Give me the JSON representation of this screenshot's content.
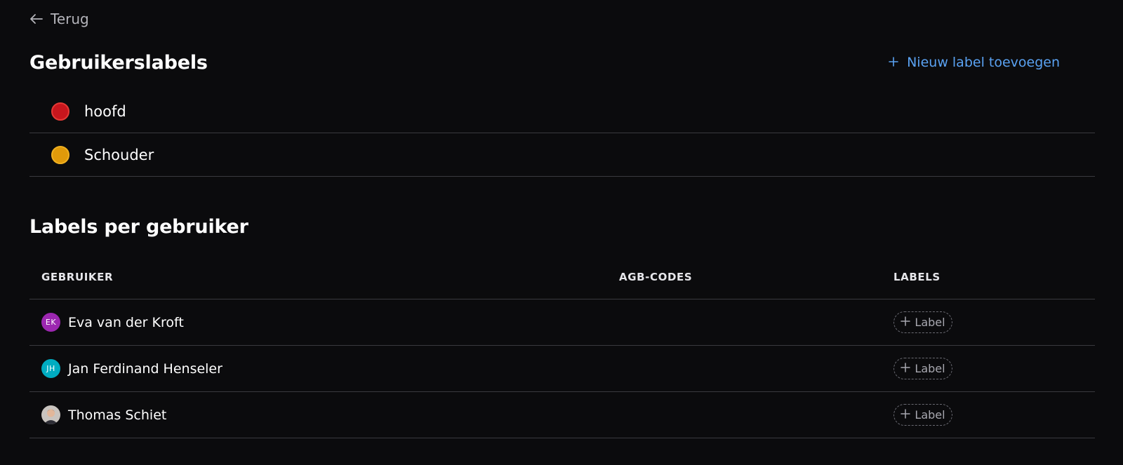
{
  "nav": {
    "back_label": "Terug"
  },
  "user_labels": {
    "title": "Gebruikerslabels",
    "add_label": "Nieuw label toevoegen",
    "items": [
      {
        "name": "hoofd",
        "color": "#c8161d",
        "border": "#e53935"
      },
      {
        "name": "Schouder",
        "color": "#e09a0a",
        "border": "#f0b020"
      }
    ]
  },
  "labels_per_user": {
    "title": "Labels per gebruiker",
    "columns": {
      "user": "GEBRUIKER",
      "agb": "AGB-CODES",
      "labels": "LABELS"
    },
    "rows": [
      {
        "initials": "EK",
        "name": "Eva van der Kroft",
        "avatar_color": "#9c27b0",
        "agb": "",
        "label_button": "Label"
      },
      {
        "initials": "JH",
        "name": "Jan Ferdinand Henseler",
        "avatar_color": "#00acc1",
        "agb": "",
        "label_button": "Label"
      },
      {
        "initials": "",
        "name": "Thomas Schiet",
        "avatar_color": "#8a8078",
        "agb": "",
        "label_button": "Label",
        "avatar_type": "photo"
      }
    ]
  },
  "colors": {
    "background": "#0b0b0d",
    "accent": "#5aa2f2",
    "divider": "#3a3a3f"
  }
}
